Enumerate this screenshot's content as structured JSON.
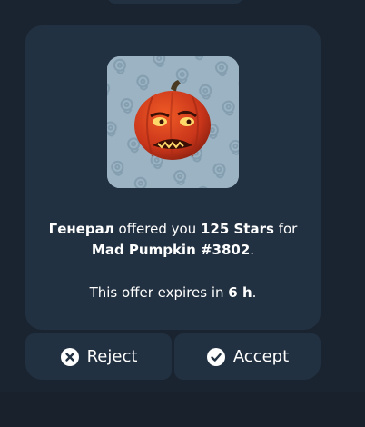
{
  "offer": {
    "sender": "Генерал",
    "offered_text": " offered you ",
    "amount": "125 Stars",
    "for_text": " for",
    "item": "Mad Pumpkin #3802",
    "item_suffix": ".",
    "expires_prefix": "This offer expires in ",
    "expires_value": "6 h",
    "expires_suffix": "."
  },
  "actions": {
    "reject_label": "Reject",
    "accept_label": "Accept"
  },
  "icons": {
    "reject": "close-circle-icon",
    "accept": "check-circle-icon",
    "gift": "mad-pumpkin-sticker"
  },
  "colors": {
    "background": "#1a2430",
    "card": "#223141",
    "tile": "#9bb3c3",
    "pumpkin": "#d8441c",
    "text": "#ffffff"
  }
}
